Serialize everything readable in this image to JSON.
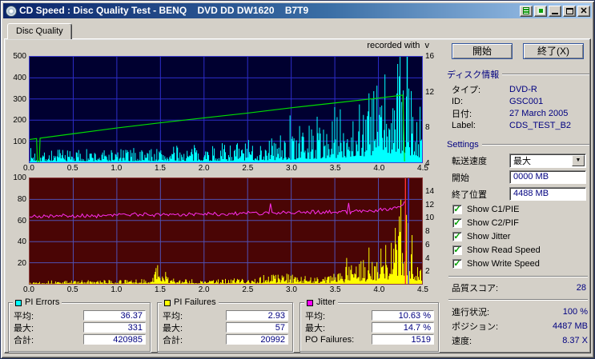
{
  "window": {
    "title": "CD Speed : Disc Quality Test - BENQ    DVD DD DW1620    B7T9"
  },
  "tab": {
    "label": "Disc Quality"
  },
  "recorded_with": "recorded with  v",
  "controls": {
    "start_button": "開始",
    "exit_button": "終了(X)",
    "disc_info": {
      "title": "ディスク情報",
      "rows": [
        {
          "label": "タイプ:",
          "value": "DVD-R"
        },
        {
          "label": "ID:",
          "value": "GSC001"
        },
        {
          "label": "日付:",
          "value": "27 March 2005"
        },
        {
          "label": "Label:",
          "value": "CDS_TEST_B2"
        }
      ]
    },
    "settings": {
      "title": "Settings",
      "speed_label": "転送速度",
      "speed_value": "最大",
      "start_label": "開始",
      "start_value": "0000 MB",
      "end_label": "終了位置",
      "end_value": "4488 MB",
      "checkboxes": [
        "Show C1/PIE",
        "Show C2/PIF",
        "Show Jitter",
        "Show Read Speed",
        "Show Write Speed"
      ]
    },
    "quality_score": {
      "label": "品質スコア:",
      "value": "28"
    },
    "progress": [
      {
        "label": "進行状況:",
        "value": "100 %"
      },
      {
        "label": "ポジション:",
        "value": "4487 MB"
      },
      {
        "label": "速度:",
        "value": "8.37 X"
      }
    ]
  },
  "stats": [
    {
      "title": "PI Errors",
      "swatch": "#00ffff",
      "rows": [
        {
          "label": "平均:",
          "value": "36.37"
        },
        {
          "label": "最大:",
          "value": "331"
        },
        {
          "label": "合計:",
          "value": "420985"
        }
      ]
    },
    {
      "title": "PI Failures",
      "swatch": "#ffff00",
      "rows": [
        {
          "label": "平均:",
          "value": "2.93"
        },
        {
          "label": "最大:",
          "value": "57"
        },
        {
          "label": "合計:",
          "value": "20992"
        }
      ]
    },
    {
      "title": "Jitter",
      "swatch": "#ff00ff",
      "rows": [
        {
          "label": "平均:",
          "value": "10.63 %"
        },
        {
          "label": "最大:",
          "value": "14.7 %"
        },
        {
          "label": "PO Failures:",
          "value": "1519"
        }
      ]
    }
  ],
  "chart_data": [
    {
      "type": "area",
      "name": "PI Errors + Read Speed",
      "bg": "#000030",
      "grid": "#2d2dc8",
      "x_range": [
        0,
        4.5
      ],
      "x_ticks": [
        "0.0",
        "0.5",
        "1.0",
        "1.5",
        "2.0",
        "2.5",
        "3.0",
        "3.5",
        "4.0",
        "4.5"
      ],
      "y_left": {
        "range": [
          0,
          500
        ],
        "ticks": [
          500,
          400,
          300,
          200,
          100
        ]
      },
      "y_right": {
        "range": [
          4,
          16
        ],
        "ticks": [
          16,
          12,
          8,
          4
        ]
      },
      "series": [
        {
          "name": "PI Errors",
          "color": "#00ffff",
          "kind": "spike-area",
          "axis": "left",
          "seed": 7,
          "envelope": [
            [
              0,
              45
            ],
            [
              0.4,
              40
            ],
            [
              0.9,
              42
            ],
            [
              1.3,
              46
            ],
            [
              1.7,
              50
            ],
            [
              2.1,
              56
            ],
            [
              2.5,
              68
            ],
            [
              2.8,
              84
            ],
            [
              3.0,
              100
            ],
            [
              3.2,
              128
            ],
            [
              3.5,
              168
            ],
            [
              3.7,
              205
            ],
            [
              3.9,
              245
            ],
            [
              4.05,
              285
            ],
            [
              4.2,
              322
            ],
            [
              4.3,
              331
            ],
            [
              4.38,
              258
            ],
            [
              4.45,
              180
            ]
          ]
        },
        {
          "name": "Read Speed",
          "color": "#00dd00",
          "kind": "line",
          "axis": "right",
          "points": [
            [
              0,
              6.6
            ],
            [
              0.08,
              6.7
            ],
            [
              0.1,
              1.1
            ],
            [
              0.12,
              6.75
            ],
            [
              0.5,
              7.25
            ],
            [
              1.0,
              7.9
            ],
            [
              1.5,
              8.5
            ],
            [
              2.0,
              9.05
            ],
            [
              2.5,
              9.6
            ],
            [
              3.0,
              10.2
            ],
            [
              3.5,
              10.75
            ],
            [
              4.0,
              11.3
            ],
            [
              4.28,
              11.65
            ],
            [
              4.3,
              4.1
            ]
          ]
        }
      ],
      "markers": [
        {
          "x": 4.33,
          "color": "#00ffff"
        }
      ]
    },
    {
      "type": "area",
      "name": "PI Failures + Jitter",
      "bg": "#4a0505",
      "grid": "#5050b4",
      "x_range": [
        0,
        4.5
      ],
      "x_ticks": [
        "0.0",
        "0.5",
        "1.0",
        "1.5",
        "2.0",
        "2.5",
        "3.0",
        "3.5",
        "4.0",
        "4.5"
      ],
      "y_left": {
        "range": [
          0,
          100
        ],
        "ticks": [
          100,
          80,
          60,
          40,
          20
        ]
      },
      "y_right": {
        "range": [
          0,
          16
        ],
        "ticks": [
          14,
          12,
          10,
          8,
          6,
          4,
          2
        ]
      },
      "series": [
        {
          "name": "PI Failures",
          "color": "#ffff00",
          "kind": "spike-area",
          "axis": "left",
          "seed": 13,
          "envelope": [
            [
              0,
              2
            ],
            [
              0.6,
              2.2
            ],
            [
              1.1,
              2.6
            ],
            [
              1.35,
              3
            ],
            [
              1.45,
              10
            ],
            [
              1.5,
              16
            ],
            [
              1.55,
              8
            ],
            [
              1.7,
              3
            ],
            [
              2.2,
              3
            ],
            [
              2.6,
              4.5
            ],
            [
              2.85,
              8
            ],
            [
              3.05,
              5
            ],
            [
              3.3,
              6
            ],
            [
              3.55,
              9
            ],
            [
              3.75,
              14
            ],
            [
              3.9,
              20
            ],
            [
              4.05,
              28
            ],
            [
              4.2,
              42
            ],
            [
              4.3,
              57
            ],
            [
              4.38,
              36
            ],
            [
              4.45,
              22
            ]
          ]
        },
        {
          "name": "Jitter",
          "color": "#ff2ef0",
          "kind": "noisy-line",
          "axis": "right",
          "seed": 21,
          "noise": 0.3,
          "envelope": [
            [
              0,
              10.2
            ],
            [
              0.4,
              10.35
            ],
            [
              0.8,
              10.3
            ],
            [
              1.2,
              10.5
            ],
            [
              1.6,
              10.45
            ],
            [
              2.0,
              10.6
            ],
            [
              2.4,
              10.65
            ],
            [
              2.8,
              10.8
            ],
            [
              3.2,
              10.9
            ],
            [
              3.6,
              10.85
            ],
            [
              3.9,
              11.1
            ],
            [
              4.1,
              11.3
            ],
            [
              4.25,
              11.5
            ],
            [
              4.3,
              12.3
            ]
          ]
        }
      ],
      "markers": [
        {
          "x": 4.31,
          "color": "#ff3232"
        },
        {
          "x": 4.345,
          "color": "#4040ff"
        }
      ]
    }
  ]
}
